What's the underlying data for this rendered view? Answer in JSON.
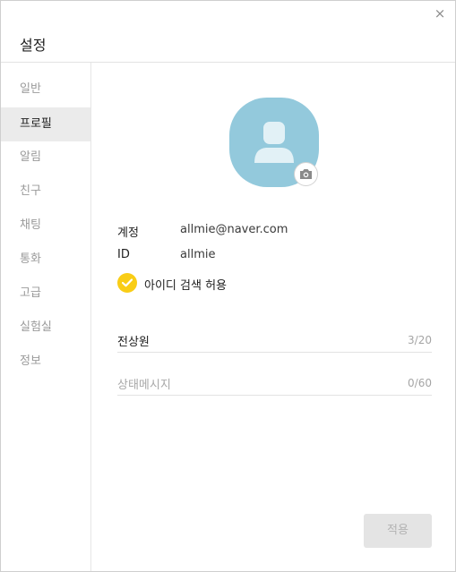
{
  "window": {
    "title": "설정",
    "close_symbol": "×"
  },
  "sidebar": {
    "items": [
      {
        "label": "일반",
        "active": false
      },
      {
        "label": "프로필",
        "active": true
      },
      {
        "label": "알림",
        "active": false
      },
      {
        "label": "친구",
        "active": false
      },
      {
        "label": "채팅",
        "active": false
      },
      {
        "label": "통화",
        "active": false
      },
      {
        "label": "고급",
        "active": false
      },
      {
        "label": "실험실",
        "active": false
      },
      {
        "label": "정보",
        "active": false
      }
    ]
  },
  "profile": {
    "avatar_icon": "user-silhouette-icon",
    "camera_icon": "camera-icon",
    "account_label": "계정",
    "account_value": "allmie@naver.com",
    "id_label": "ID",
    "id_value": "allmie",
    "allow_id_search": {
      "label": "아이디 검색 허용",
      "checked": true
    },
    "name_field": {
      "value": "전상원",
      "count": "3/20"
    },
    "status_field": {
      "placeholder": "상태메시지",
      "count": "0/60"
    }
  },
  "footer": {
    "apply_label": "적용"
  },
  "colors": {
    "avatar_bg": "#93c9dc",
    "check_accent": "#f9cd16",
    "active_item_bg": "#ebebeb",
    "disabled_button_bg": "#e4e4e4"
  }
}
